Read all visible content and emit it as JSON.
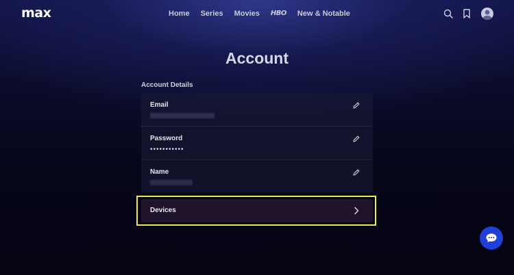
{
  "nav": {
    "logo": "max",
    "links": [
      "Home",
      "Series",
      "Movies",
      "HBO",
      "New & Notable"
    ],
    "icons": [
      "search-icon",
      "bookmark-icon",
      "profile-avatar"
    ]
  },
  "page": {
    "title": "Account",
    "section_label": "Account Details"
  },
  "account_rows": {
    "email": {
      "label": "Email",
      "value": ""
    },
    "password": {
      "label": "Password",
      "value": "•••••••••••"
    },
    "name": {
      "label": "Name",
      "value": ""
    }
  },
  "devices": {
    "label": "Devices",
    "highlight_color": "#efe94a"
  },
  "colors": {
    "background_top": "#121448",
    "background_bottom": "#040412",
    "chat_button": "#1f3fd6"
  },
  "chat": {
    "icon": "chat-bubble-icon"
  }
}
